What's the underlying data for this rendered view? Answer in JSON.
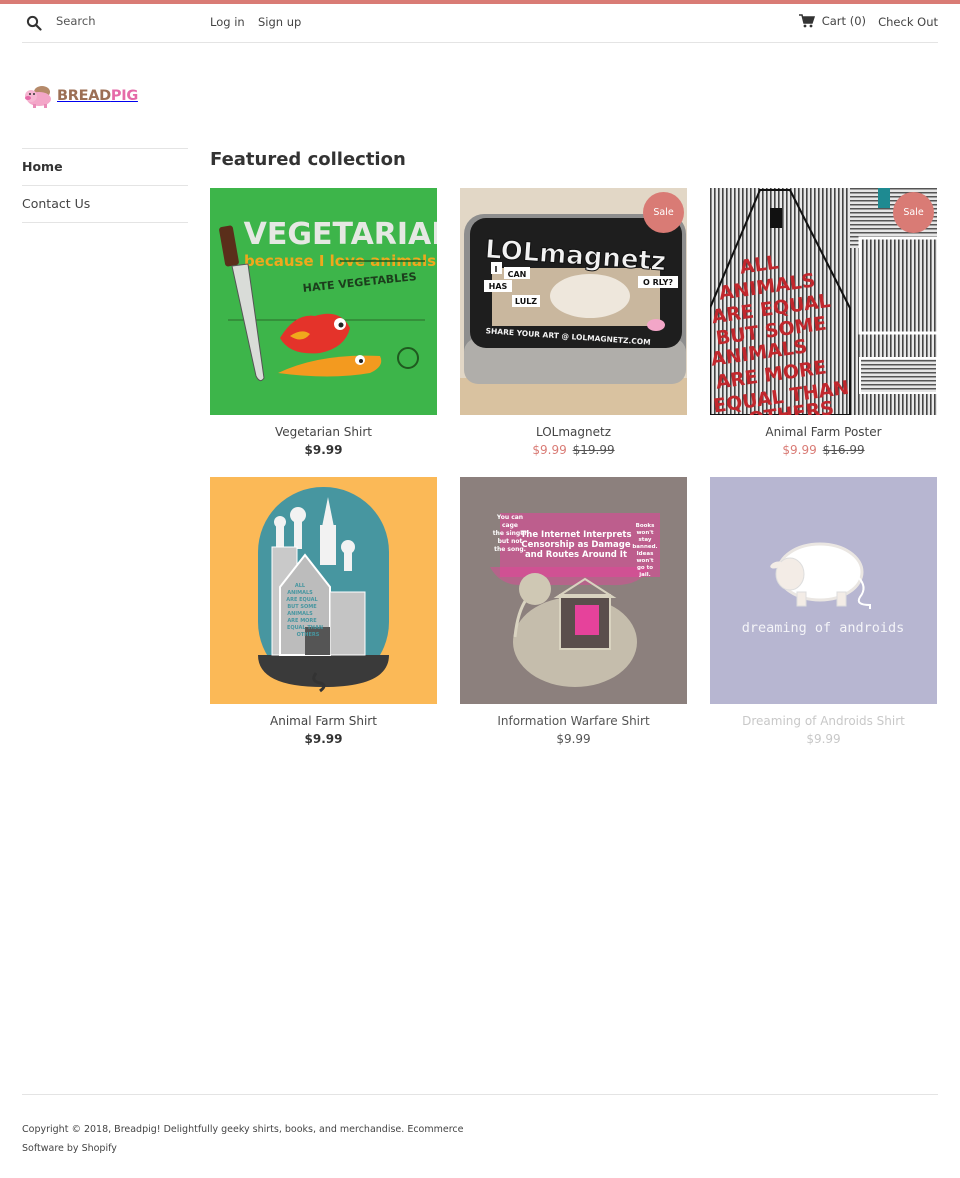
{
  "colors": {
    "accent": "#d97b75",
    "text": "#333333",
    "border": "#e4e4e4",
    "logo_bread": "#9c6f55",
    "logo_pig": "#e56aa8"
  },
  "header": {
    "search_placeholder": "Search",
    "search_icon": "search-icon",
    "login_label": "Log in",
    "signup_label": "Sign up",
    "cart_icon": "cart-icon",
    "cart_label": "Cart (0)",
    "checkout_label": "Check Out"
  },
  "logo": {
    "bread": "BREAD",
    "pig": "PIG"
  },
  "sidebar": {
    "items": [
      {
        "label": "Home",
        "active": true
      },
      {
        "label": "Contact Us",
        "active": false
      }
    ]
  },
  "main": {
    "section_title": "Featured collection",
    "products": [
      {
        "title": "Vegetarian Shirt",
        "price": "$9.99",
        "compare_price": null,
        "on_sale": false
      },
      {
        "title": "LOLmagnetz",
        "price": "$9.99",
        "compare_price": "$19.99",
        "on_sale": true,
        "badge": "Sale"
      },
      {
        "title": "Animal Farm Poster",
        "price": "$9.99",
        "compare_price": "$16.99",
        "on_sale": true,
        "badge": "Sale"
      },
      {
        "title": "Animal Farm Shirt",
        "price": "$9.99",
        "compare_price": null,
        "on_sale": false
      },
      {
        "title": "Information Warfare Shirt",
        "price": "$9.99",
        "compare_price": null,
        "on_sale": false
      },
      {
        "title": "Dreaming of Androids Shirt",
        "price": "$9.99",
        "compare_price": null,
        "on_sale": false
      }
    ],
    "image_text": {
      "veg_title": "VEGETARIAN",
      "veg_sub": "because I love animals",
      "veg_hate": "HATE VEGETABLES",
      "lol_title": "LOLmagnetz",
      "lol_i": "I",
      "lol_can": "CAN",
      "lol_has": "HAS",
      "lol_lulz": "LULZ",
      "lol_orly": "O RLY?",
      "lol_share": "SHARE YOUR ART @ LOLMAGNETZ.COM",
      "af_lines": [
        "ALL",
        "ANIMALS",
        "ARE EQUAL",
        "BUT SOME",
        "ANIMALS",
        "ARE MORE",
        "EQUAL THAN",
        "OTHERS"
      ],
      "iw_main": [
        "The Internet Interprets",
        "Censorship as Damage",
        "and Routes Around It"
      ],
      "iw_left": [
        "You can",
        "cage",
        "the singer",
        "but not",
        "the song."
      ],
      "iw_right": [
        "Books",
        "won't",
        "stay",
        "banned.",
        "Ideas",
        "won't",
        "go to",
        "jail."
      ],
      "android_text": "dreaming of androids"
    }
  },
  "footer": {
    "copyright": "Copyright © 2018, Breadpig! Delightfully geeky shirts, books, and merchandise.",
    "powered": "Ecommerce Software by Shopify"
  }
}
